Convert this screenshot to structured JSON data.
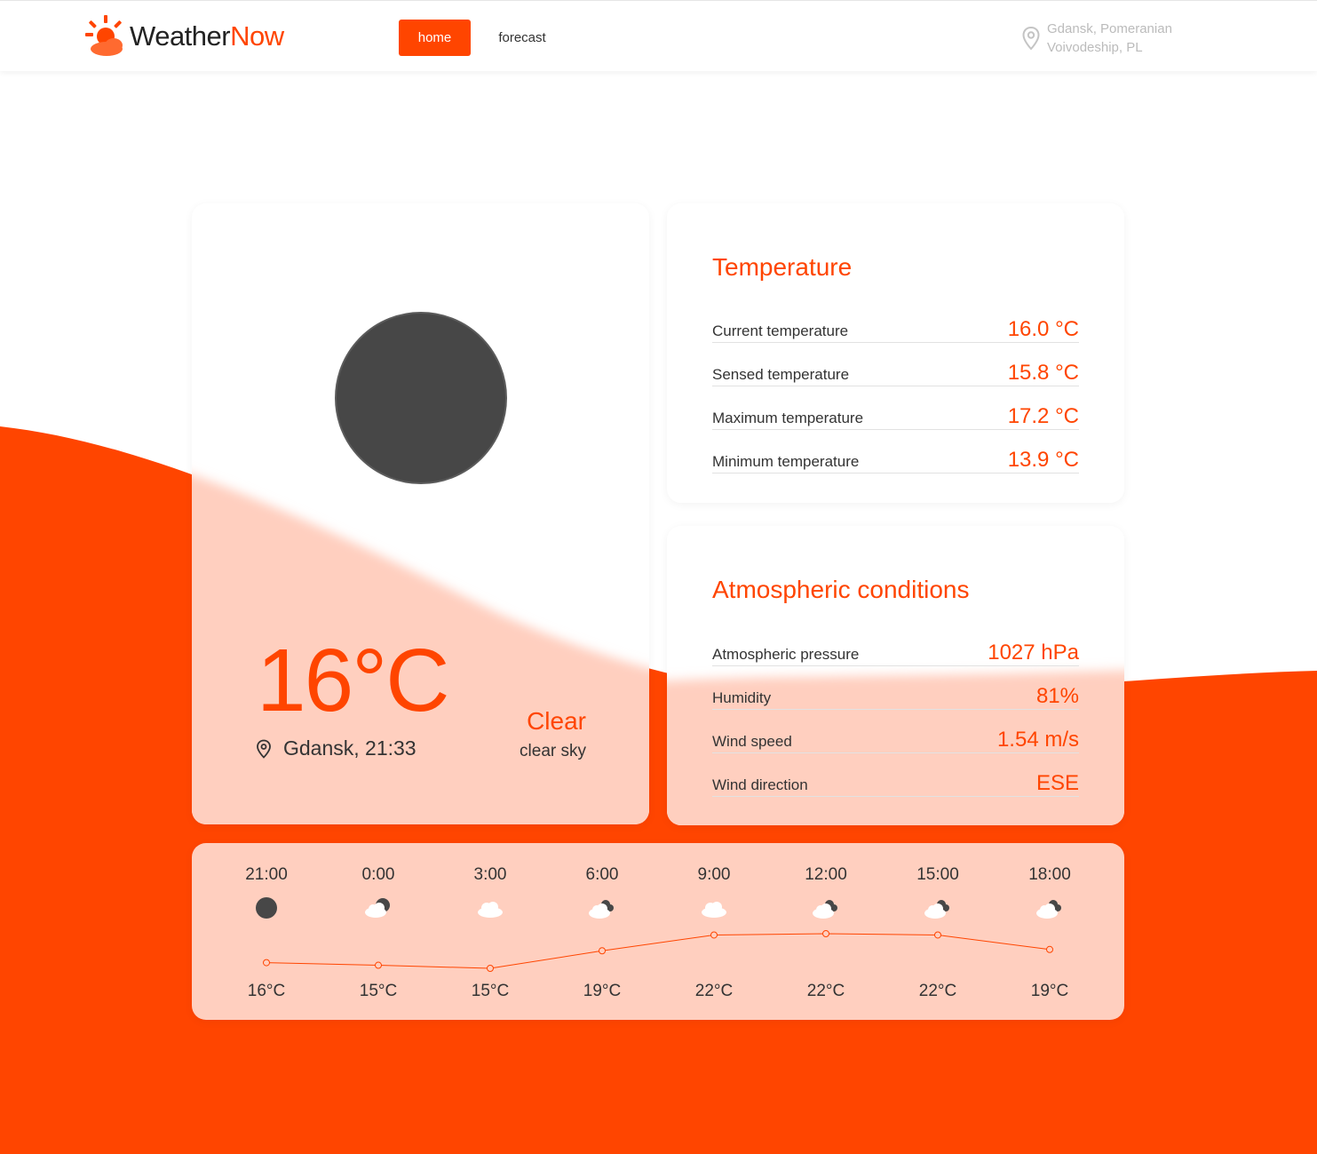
{
  "header": {
    "logo_part1": "Weather",
    "logo_part2": "Now",
    "nav_home": "home",
    "nav_forecast": "forecast",
    "location_line1": "Gdansk, Pomeranian",
    "location_line2": "Voivodeship, PL"
  },
  "colors": {
    "accent": "#ff4500",
    "card_tint": "#ffcfbf",
    "icon_dark": "#474747"
  },
  "current": {
    "temp": "16°C",
    "city_time": "Gdansk, 21:33",
    "condition": "Clear",
    "description": "clear sky",
    "icon": "moon-icon"
  },
  "temperature": {
    "title": "Temperature",
    "rows": [
      {
        "label": "Current temperature",
        "value": "16.0 °C"
      },
      {
        "label": "Sensed temperature",
        "value": "15.8 °C"
      },
      {
        "label": "Maximum temperature",
        "value": "17.2 °C"
      },
      {
        "label": "Minimum temperature",
        "value": "13.9 °C"
      }
    ]
  },
  "atmospheric": {
    "title": "Atmospheric conditions",
    "rows": [
      {
        "label": "Atmospheric pressure",
        "value": "1027 hPa"
      },
      {
        "label": "Humidity",
        "value": "81%"
      },
      {
        "label": "Wind speed",
        "value": "1.54 m/s"
      },
      {
        "label": "Wind direction",
        "value": "ESE"
      }
    ]
  },
  "hourly": [
    {
      "time": "21:00",
      "temp": "16°C",
      "t": 16.0,
      "icon": "moon-icon"
    },
    {
      "time": "0:00",
      "temp": "15°C",
      "t": 15.4,
      "icon": "moon-cloud-icon"
    },
    {
      "time": "3:00",
      "temp": "15°C",
      "t": 14.7,
      "icon": "cloud-icon"
    },
    {
      "time": "6:00",
      "temp": "19°C",
      "t": 18.7,
      "icon": "broken-clouds-icon"
    },
    {
      "time": "9:00",
      "temp": "22°C",
      "t": 22.3,
      "icon": "cloud-icon"
    },
    {
      "time": "12:00",
      "temp": "22°C",
      "t": 22.6,
      "icon": "broken-clouds-icon"
    },
    {
      "time": "15:00",
      "temp": "22°C",
      "t": 22.3,
      "icon": "broken-clouds-icon"
    },
    {
      "time": "18:00",
      "temp": "19°C",
      "t": 19.0,
      "icon": "broken-clouds-icon"
    }
  ]
}
